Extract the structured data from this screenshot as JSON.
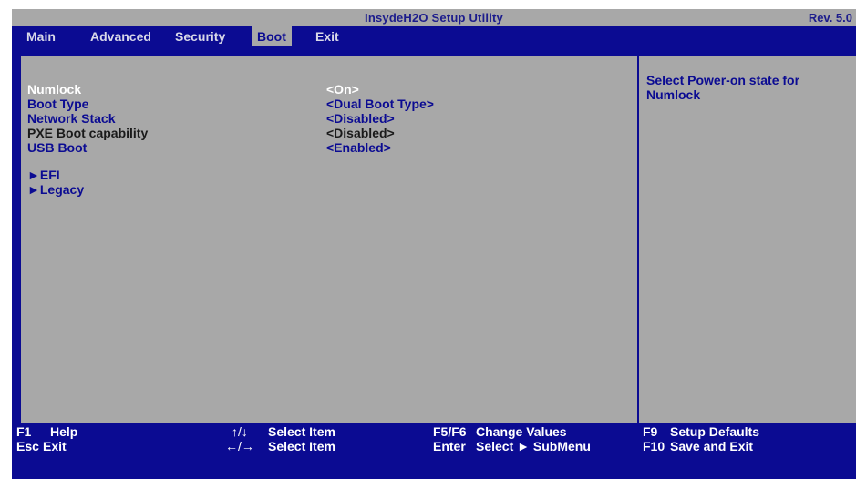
{
  "header": {
    "title": "InsydeH2O Setup Utility",
    "revision": "Rev. 5.0"
  },
  "menu": {
    "tabs": [
      {
        "label": "Main"
      },
      {
        "label": "Advanced"
      },
      {
        "label": "Security"
      },
      {
        "label": "Boot",
        "active": true
      },
      {
        "label": "Exit"
      }
    ]
  },
  "settings": [
    {
      "label": "Numlock",
      "value": "<On>",
      "selected": true
    },
    {
      "label": "Boot Type",
      "value": "<Dual Boot Type>"
    },
    {
      "label": "Network Stack",
      "value": "<Disabled>"
    },
    {
      "label": "PXE Boot capability",
      "value": "<Disabled>",
      "readonly": true
    },
    {
      "label": "USB Boot",
      "value": "<Enabled>"
    }
  ],
  "submenus": [
    {
      "label": "►EFI"
    },
    {
      "label": "►Legacy"
    }
  ],
  "help": {
    "text": "Select Power-on state for Numlock"
  },
  "footer": {
    "row1": [
      {
        "key": "F1",
        "desc": "Help"
      },
      {
        "key": "↑/↓",
        "desc": "Select Item"
      },
      {
        "key": "F5/F6",
        "desc": "Change Values"
      },
      {
        "key": "F9",
        "desc": "Setup Defaults"
      }
    ],
    "row2": [
      {
        "key": "Esc",
        "desc": "Exit"
      },
      {
        "key": "←/→",
        "desc": "Select Item"
      },
      {
        "key": "Enter",
        "desc": "Select ► SubMenu"
      },
      {
        "key": "F10",
        "desc": "Save and Exit"
      }
    ]
  },
  "colors": {
    "bios_blue": "#0b0b92",
    "panel_gray": "#a8a8a8",
    "highlight_white": "#ffffff"
  }
}
